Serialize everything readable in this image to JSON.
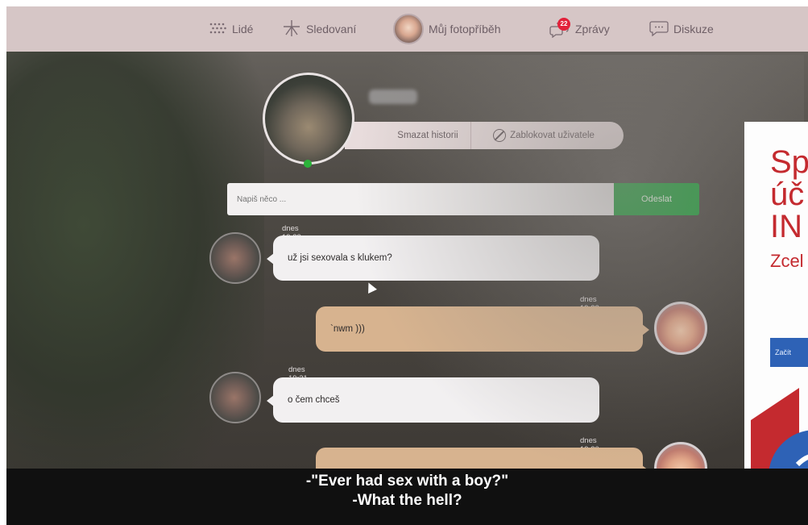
{
  "nav": {
    "people": "Lidé",
    "following": "Sledovaní",
    "my_story": "Můj fotopříběh",
    "messages": "Zprávy",
    "messages_badge": "22",
    "discussion": "Diskuze"
  },
  "profile": {
    "clear_history": "Smazat historii",
    "block_user": "Zablokovat uživatele"
  },
  "composer": {
    "placeholder": "Napiš něco ...",
    "send": "Odeslat"
  },
  "messages": [
    {
      "time": "dnes 19:23",
      "text": "už jsi sexovala s klukem?",
      "from": "other"
    },
    {
      "time": "dnes 19:22",
      "text": "`nwm )))",
      "from": "me"
    },
    {
      "time": "dnes 19:21",
      "text": "o čem chceš",
      "from": "other"
    },
    {
      "time": "dnes 19:20",
      "text": "",
      "from": "me"
    }
  ],
  "ad": {
    "line1": "Sp",
    "line2": "úč",
    "line3": "IN",
    "sub": "Zcel",
    "button": "Začít"
  },
  "subtitles": {
    "line1": "-\"Ever had sex with a boy?\"",
    "line2": "-What the hell?"
  },
  "colors": {
    "nav_bg": "#d6c6c6",
    "send_green": "#1fa23b",
    "outgoing_bubble": "#d7b38f",
    "incoming_bubble": "#f2f0f1",
    "ad_red": "#c42a2f",
    "ad_blue": "#2e62b6",
    "online": "#2bb33a",
    "badge_red": "#e2213a"
  }
}
